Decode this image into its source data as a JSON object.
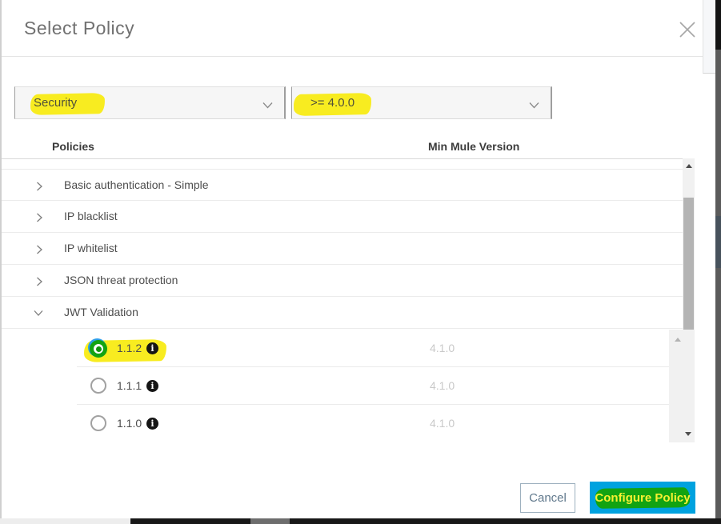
{
  "modal": {
    "title": "Select Policy",
    "close_icon": "x-icon"
  },
  "filters": {
    "category_value": "Security",
    "version_value": ">= 4.0.0"
  },
  "table": {
    "col_policies": "Policies",
    "col_min_mule": "Min Mule Version",
    "policies": [
      {
        "label": "Basic authentication - Simple",
        "expanded": false
      },
      {
        "label": "IP blacklist",
        "expanded": false
      },
      {
        "label": "IP whitelist",
        "expanded": false
      },
      {
        "label": "JSON threat protection",
        "expanded": false
      },
      {
        "label": "JWT Validation",
        "expanded": true
      }
    ],
    "versions": [
      {
        "version": "1.1.2",
        "min_mule_version": "4.1.0",
        "selected": true,
        "highlighted": true
      },
      {
        "version": "1.1.1",
        "min_mule_version": "4.1.0",
        "selected": false,
        "highlighted": false
      },
      {
        "version": "1.1.0",
        "min_mule_version": "4.1.0",
        "selected": false,
        "highlighted": false
      }
    ]
  },
  "footer": {
    "cancel_label": "Cancel",
    "configure_label": "Configure Policy"
  },
  "colors": {
    "accent_blue": "#00a2df",
    "highlight_yellow": "#f8ec20",
    "annotation_green": "#12a312",
    "muted_version_text": "#c9c9c9"
  }
}
